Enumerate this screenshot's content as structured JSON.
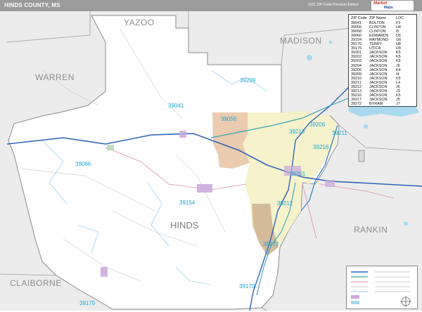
{
  "header": {
    "title": "HINDS COUNTY, MS",
    "edition": "2021 ZIP Code Premium Edition",
    "logo_line1": "Market",
    "logo_line2": "Maps"
  },
  "map": {
    "county_name": "HINDS",
    "neighbor_counties": [
      {
        "name": "YAZOO"
      },
      {
        "name": "MADISON"
      },
      {
        "name": "WARREN"
      },
      {
        "name": "RANKIN"
      },
      {
        "name": "CLAIBORNE"
      }
    ],
    "zip_labels": [
      {
        "code": "39209"
      },
      {
        "code": "39041"
      },
      {
        "code": "39056"
      },
      {
        "code": "39213"
      },
      {
        "code": "39206"
      },
      {
        "code": "39211"
      },
      {
        "code": "39216"
      },
      {
        "code": "39066"
      },
      {
        "code": "39201"
      },
      {
        "code": "39154"
      },
      {
        "code": "39212"
      },
      {
        "code": "39272"
      },
      {
        "code": "39170"
      },
      {
        "code": "39175"
      }
    ]
  },
  "zip_table": {
    "headers": [
      "ZIP Code",
      "ZIP Name",
      "LOC"
    ],
    "rows": [
      [
        "39041",
        "BOLTON",
        "F3"
      ],
      [
        "39056",
        "CLINTON",
        "H4"
      ],
      [
        "39058",
        "CLINTON",
        "I5"
      ],
      [
        "39066",
        "EDWARDS",
        "D5"
      ],
      [
        "39154",
        "RAYMOND",
        "G6"
      ],
      [
        "39170",
        "TERRY",
        "H8"
      ],
      [
        "39175",
        "UTICA",
        "D8"
      ],
      [
        "39201",
        "JACKSON",
        "K5"
      ],
      [
        "39202",
        "JACKSON",
        "K5"
      ],
      [
        "39203",
        "JACKSON",
        "K5"
      ],
      [
        "39204",
        "JACKSON",
        "J6"
      ],
      [
        "39206",
        "JACKSON",
        "K4"
      ],
      [
        "39209",
        "JACKSON",
        "I4"
      ],
      [
        "39210",
        "JACKSON",
        "K5"
      ],
      [
        "39211",
        "JACKSON",
        "L4"
      ],
      [
        "39212",
        "JACKSON",
        "J6"
      ],
      [
        "39213",
        "JACKSON",
        "J3"
      ],
      [
        "39216",
        "JACKSON",
        "K5"
      ],
      [
        "39217",
        "JACKSON",
        "J5"
      ],
      [
        "39272",
        "BYRAM",
        "J7"
      ]
    ]
  },
  "colors": {
    "outside_county": "#ececec",
    "inside_county": "#ffffff",
    "jackson_area": "#f6f1c8",
    "clinton_area": "#e8c3a3",
    "terry_area": "#cfb595",
    "water": "#a8d8ee",
    "highway_teal": "#3aa3b6",
    "interstate_blue": "#2f63b8",
    "county_border": "#8a8a8a",
    "zip_label": "#12a8d6",
    "place_purple": "#c8a8dc"
  }
}
